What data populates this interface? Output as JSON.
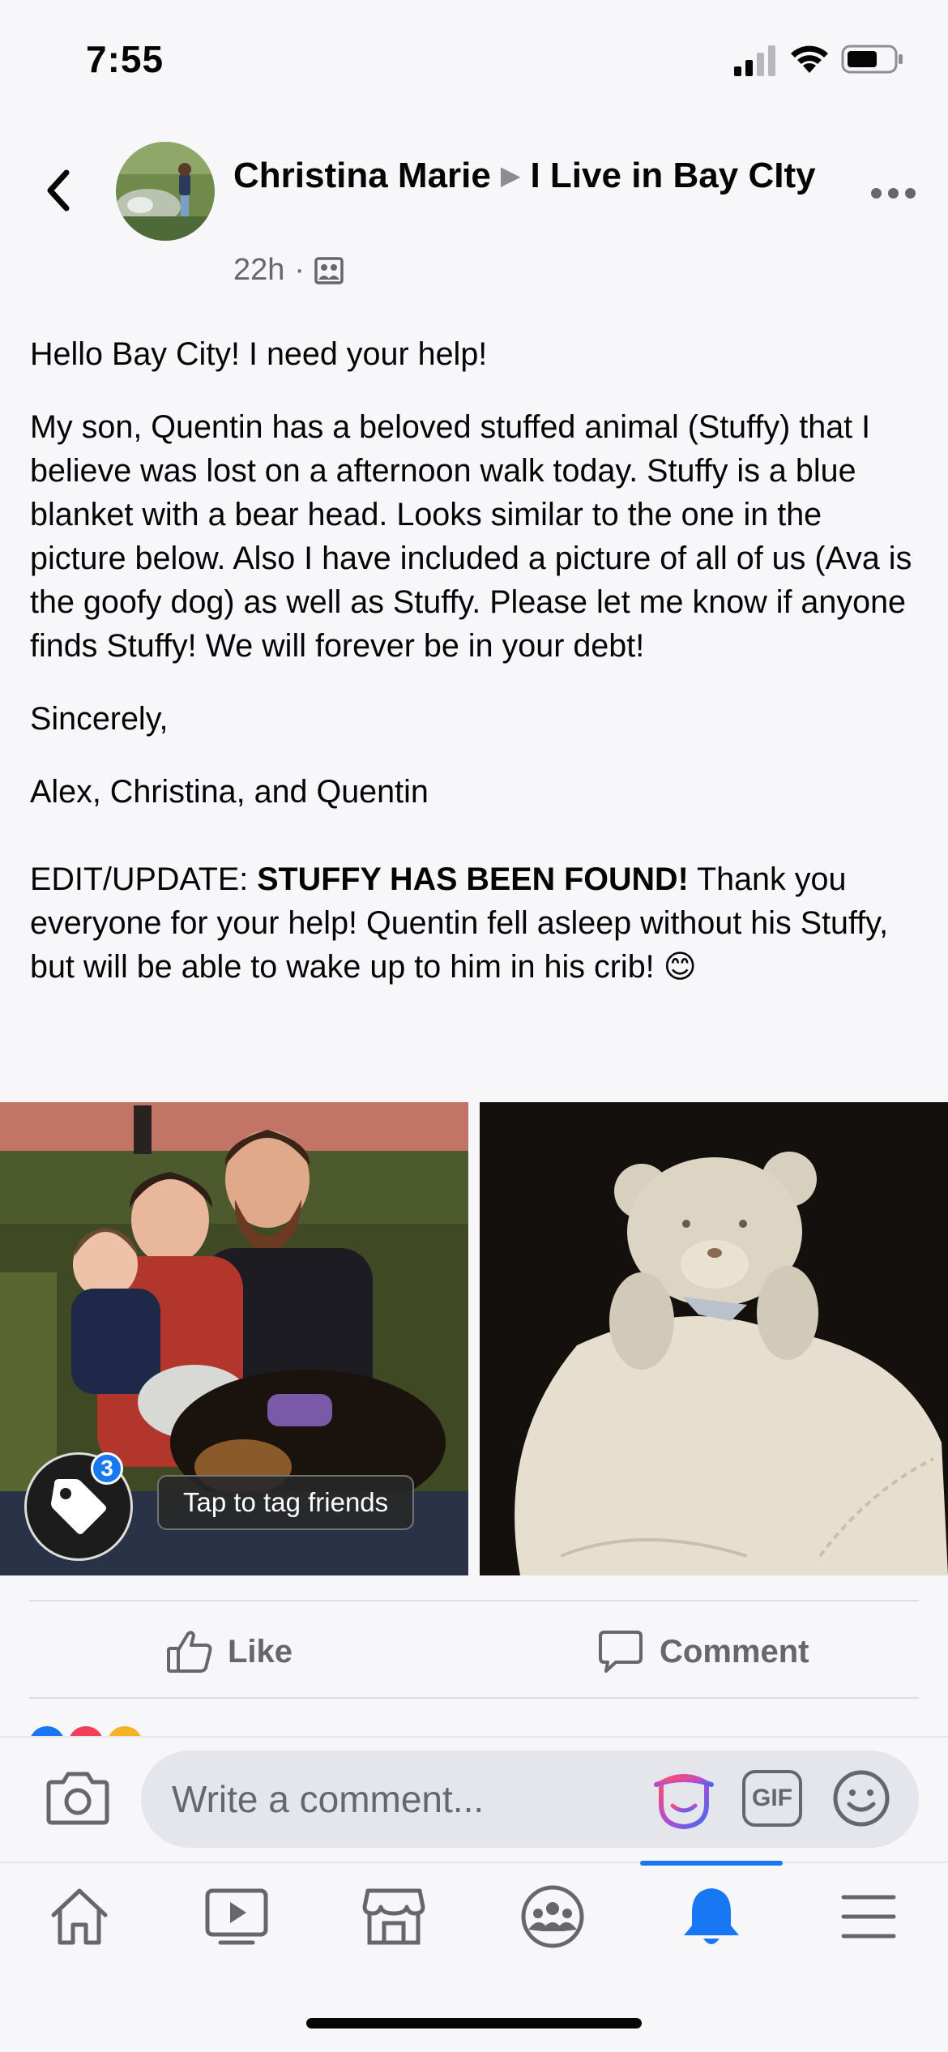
{
  "status_bar": {
    "time": "7:55"
  },
  "post": {
    "author": "Christina Marie",
    "group": "I Live in Bay CIty",
    "timestamp": "22h",
    "separator": "·",
    "body": {
      "greeting": "Hello Bay City! I need your help!",
      "paragraph": "My son, Quentin has a beloved stuffed animal (Stuffy) that I believe was lost on a afternoon walk today. Stuffy is a blue blanket with a bear head. Looks similar to the one in the picture below. Also I have included a picture of all of us (Ava is the goofy dog) as well as Stuffy. Please let me know if anyone finds Stuffy! We will forever be in your debt!",
      "closing": "Sincerely,",
      "signature": "Alex, Christina, and Quentin",
      "update_prefix": "EDIT/UPDATE: ",
      "update_bold": "STUFFY HAS BEEN FOUND!",
      "update_rest": " Thank you everyone for your help! Quentin fell asleep without his Stuffy, but will be able to wake up to him in his crib! 😊"
    },
    "photo_tag": {
      "count": "3",
      "label": "Tap to tag friends"
    },
    "actions": {
      "like_label": "Like",
      "comment_label": "Comment"
    }
  },
  "comment_bar": {
    "placeholder": "Write a comment...",
    "gif_label": "GIF"
  },
  "tab_bar": {
    "tabs": [
      "home",
      "watch",
      "marketplace",
      "groups",
      "notifications",
      "menu"
    ],
    "active": "notifications"
  },
  "colors": {
    "accent": "#1877f2",
    "secondary_text": "#65676b",
    "background": "#f7f7f9"
  }
}
